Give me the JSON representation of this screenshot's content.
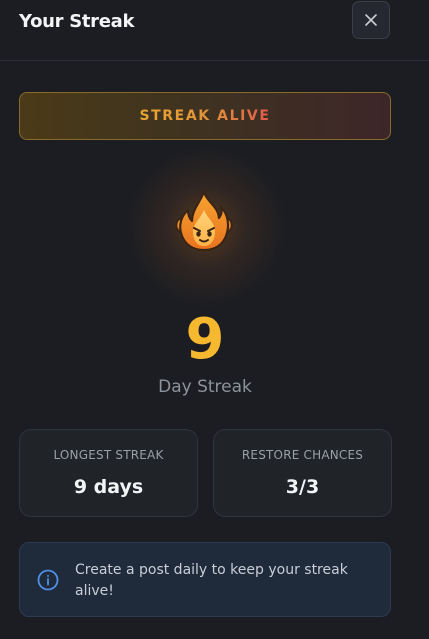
{
  "header": {
    "title": "Your Streak",
    "close_icon": "close-icon"
  },
  "banner": {
    "label": "STREAK ALIVE"
  },
  "streak": {
    "icon": "flame-icon",
    "count": "9",
    "label": "Day Streak"
  },
  "stats": {
    "longest": {
      "label": "LONGEST STREAK",
      "value": "9 days"
    },
    "restore": {
      "label": "RESTORE CHANCES",
      "value": "3/3"
    }
  },
  "info": {
    "icon": "info-icon",
    "text": "Create a post daily to keep your streak alive!"
  },
  "colors": {
    "accent": "#f5b82e",
    "background": "#1b1d22",
    "card": "#202328",
    "info_border": "#2c3b52",
    "info_icon": "#4f8fe6"
  }
}
